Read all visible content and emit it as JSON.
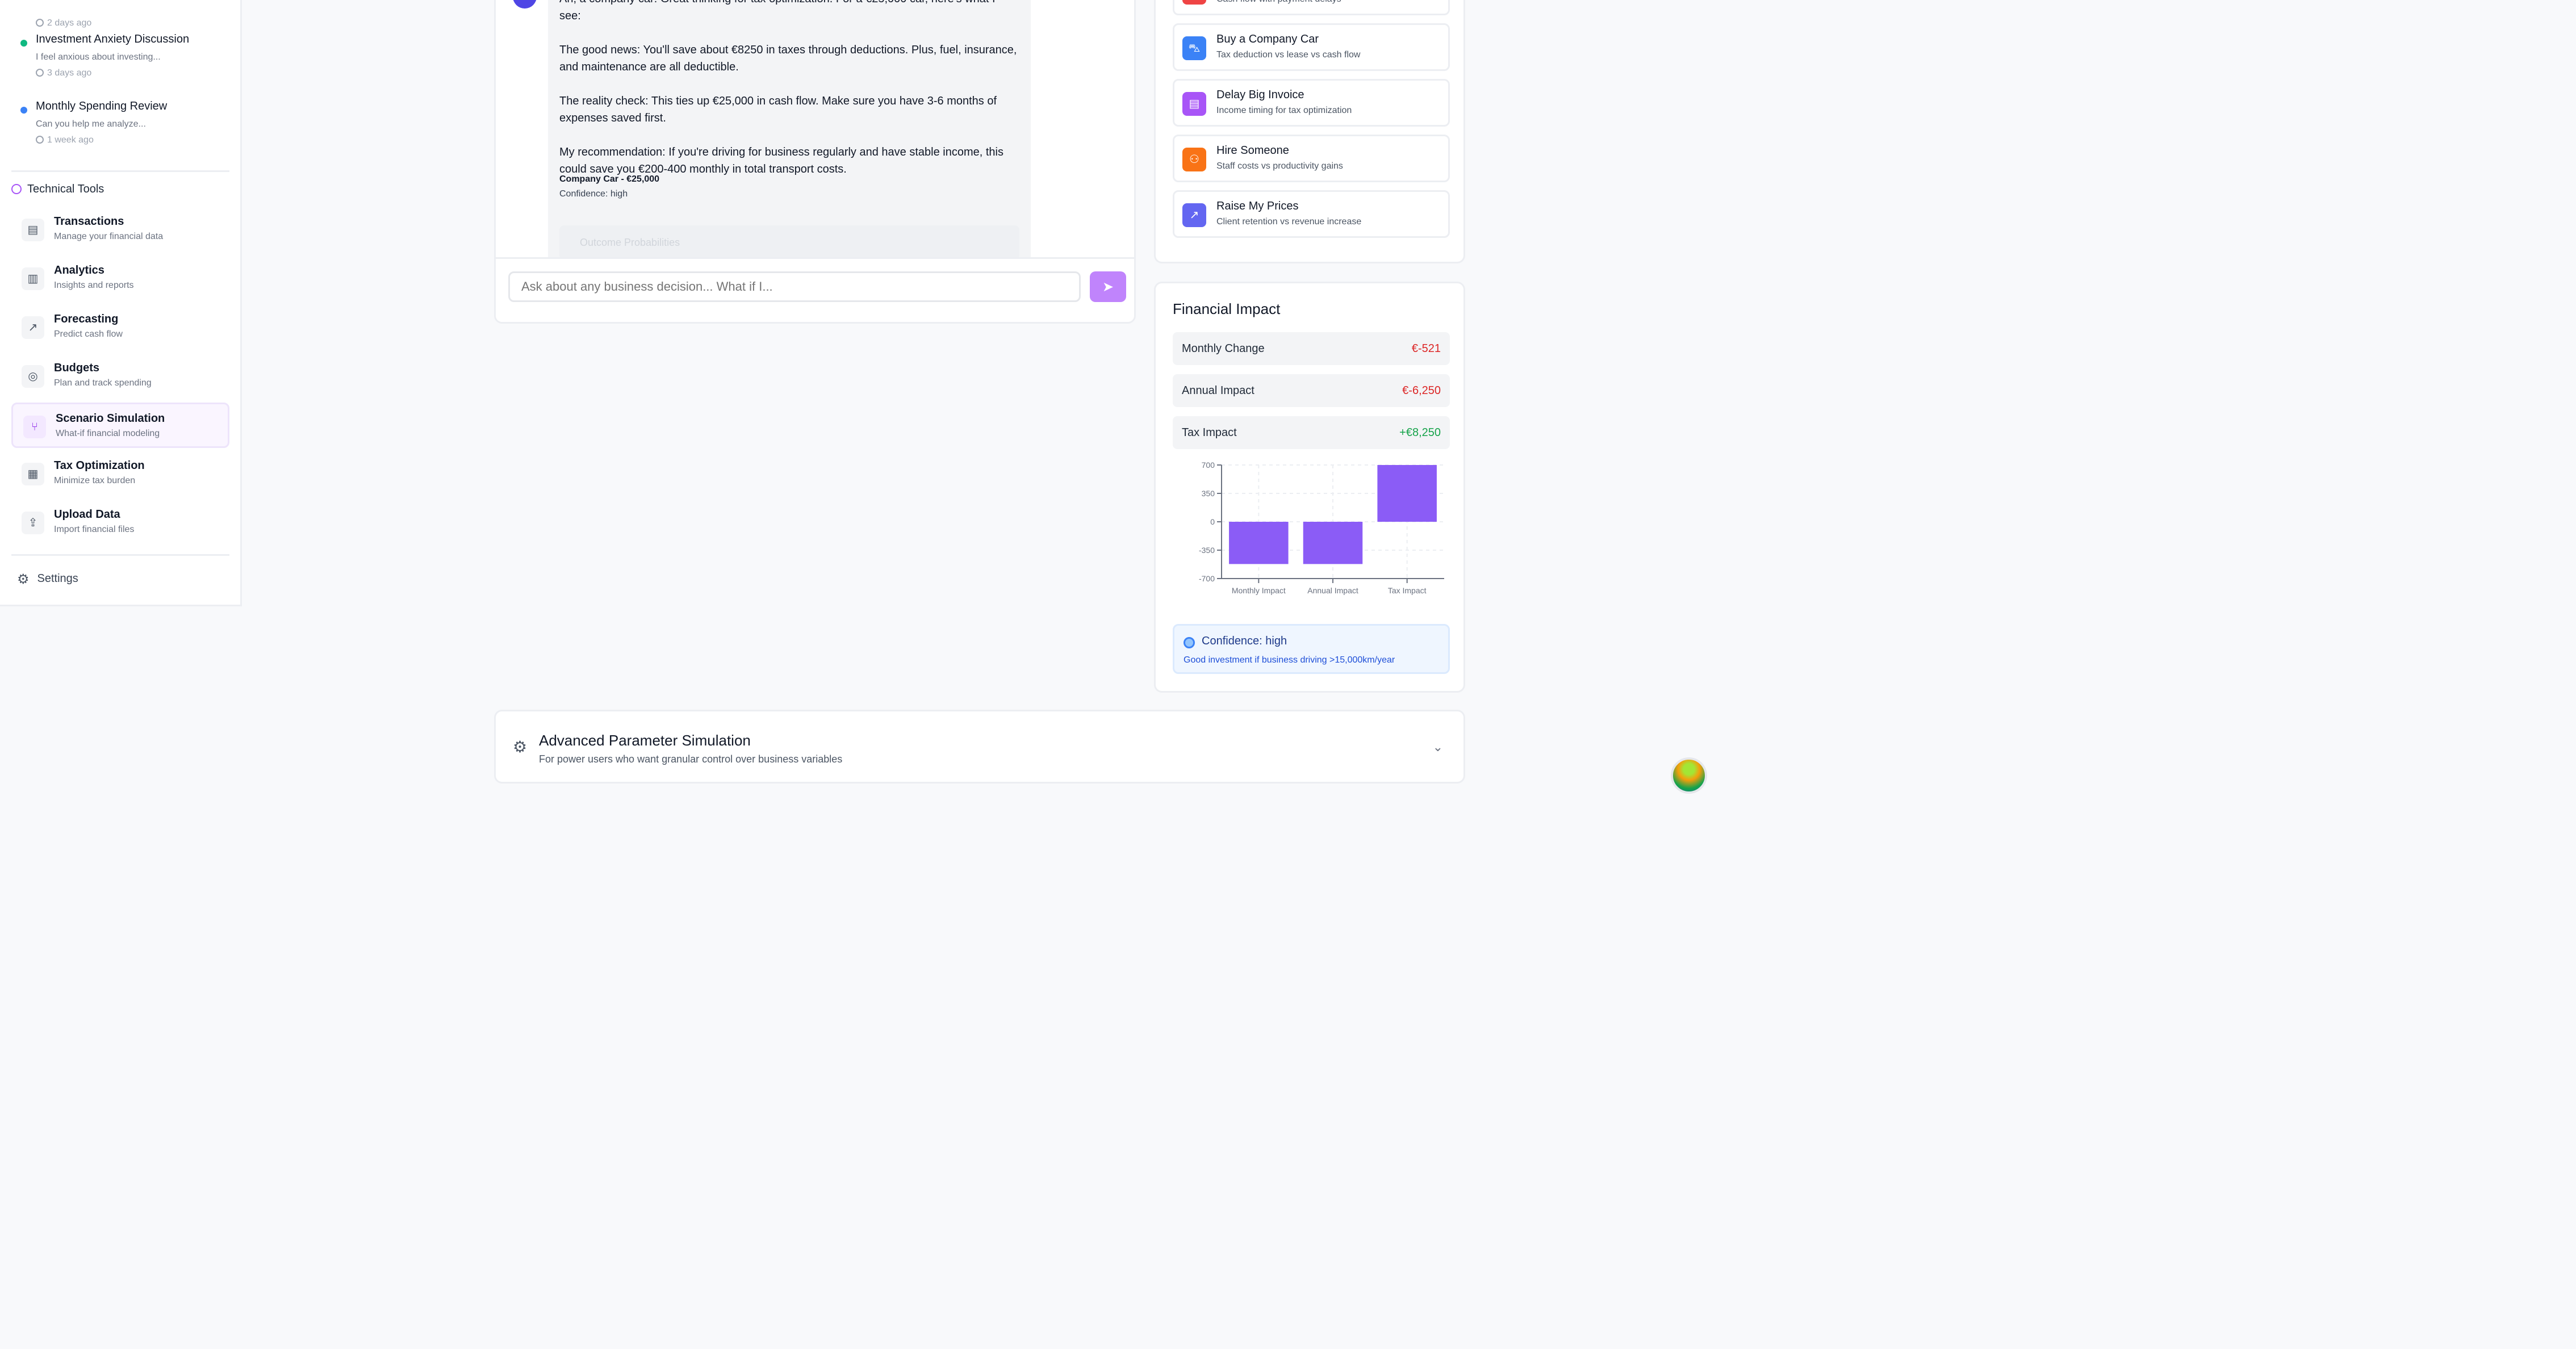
{
  "recent_chats": [
    {
      "title": "",
      "preview": "",
      "time": "2 days ago",
      "dot": "green"
    },
    {
      "title": "Investment Anxiety Discussion",
      "preview": "I feel anxious about investing...",
      "time": "3 days ago",
      "dot": "green"
    },
    {
      "title": "Monthly Spending Review",
      "preview": "Can you help me analyze...",
      "time": "1 week ago",
      "dot": "blue"
    }
  ],
  "technical_tools": {
    "title": "Technical Tools",
    "items": [
      {
        "name": "Transactions",
        "desc": "Manage your financial data",
        "icon": "document-icon",
        "glyph": "▤"
      },
      {
        "name": "Analytics",
        "desc": "Insights and reports",
        "icon": "bar-chart-icon",
        "glyph": "▥"
      },
      {
        "name": "Forecasting",
        "desc": "Predict cash flow",
        "icon": "trending-up-icon",
        "glyph": "↗"
      },
      {
        "name": "Budgets",
        "desc": "Plan and track spending",
        "icon": "target-icon",
        "glyph": "◎"
      },
      {
        "name": "Scenario Simulation",
        "desc": "What-if financial modeling",
        "icon": "git-branch-icon",
        "glyph": "⑂",
        "active": true
      },
      {
        "name": "Tax Optimization",
        "desc": "Minimize tax burden",
        "icon": "receipt-icon",
        "glyph": "▦"
      },
      {
        "name": "Upload Data",
        "desc": "Import financial files",
        "icon": "upload-icon",
        "glyph": "⇪"
      }
    ]
  },
  "settings_label": "Settings",
  "chat": {
    "message_paragraphs": [
      "Ah, a company car! Great thinking for tax optimization. For a €25,000 car, here's what I see:",
      "The good news: You'll save about €8250 in taxes through deductions. Plus, fuel, insurance, and maintenance are all deductible.",
      "The reality check: This ties up €25,000 in cash flow. Make sure you have 3-6 months of expenses saved first.",
      "My recommendation: If you're driving for business regularly and have stable income, this could save you €200-400 monthly in total transport costs."
    ],
    "card_title": "Company Car - €25,000",
    "card_confidence": "Confidence: high",
    "card_faded_label": "Outcome Probabilities",
    "input_placeholder": "Ask about any business decision... What if I..."
  },
  "quick_scenarios": [
    {
      "name": "",
      "desc": "Cash flow with payment delays",
      "color": "#ef4444",
      "icon": "alert-icon",
      "glyph": "!"
    },
    {
      "name": "Buy a Company Car",
      "desc": "Tax deduction vs lease vs cash flow",
      "color": "#3b82f6",
      "icon": "car-icon",
      "glyph": "⛍"
    },
    {
      "name": "Delay Big Invoice",
      "desc": "Income timing for tax optimization",
      "color": "#a855f7",
      "icon": "file-icon",
      "glyph": "▤"
    },
    {
      "name": "Hire Someone",
      "desc": "Staff costs vs productivity gains",
      "color": "#f97316",
      "icon": "user-plus-icon",
      "glyph": "⚇"
    },
    {
      "name": "Raise My Prices",
      "desc": "Client retention vs revenue increase",
      "color": "#6366f1",
      "icon": "trending-up-icon",
      "glyph": "↗"
    }
  ],
  "financial_impact": {
    "title": "Financial Impact",
    "metrics": [
      {
        "label": "Monthly Change",
        "value": "€-521",
        "color": "#dc2626"
      },
      {
        "label": "Annual Impact",
        "value": "€-6,250",
        "color": "#dc2626"
      },
      {
        "label": "Tax Impact",
        "value": "+€8,250",
        "color": "#16a34a"
      }
    ],
    "confidence_title": "Confidence: high",
    "confidence_note": "Good investment if business driving >15,000km/year"
  },
  "chart_data": {
    "type": "bar",
    "categories": [
      "Monthly Impact",
      "Annual Impact",
      "Tax Impact"
    ],
    "values": [
      -521,
      -521,
      700
    ],
    "ylim": [
      -700,
      700
    ],
    "yticks": [
      "700",
      "350",
      "0",
      "-350",
      "-700"
    ],
    "ytick_values": [
      700,
      350,
      0,
      -350,
      -700
    ],
    "bar_color": "#8b5cf6",
    "grid": true
  },
  "advanced": {
    "title": "Advanced Parameter Simulation",
    "subtitle": "For power users who want granular control over business variables"
  }
}
